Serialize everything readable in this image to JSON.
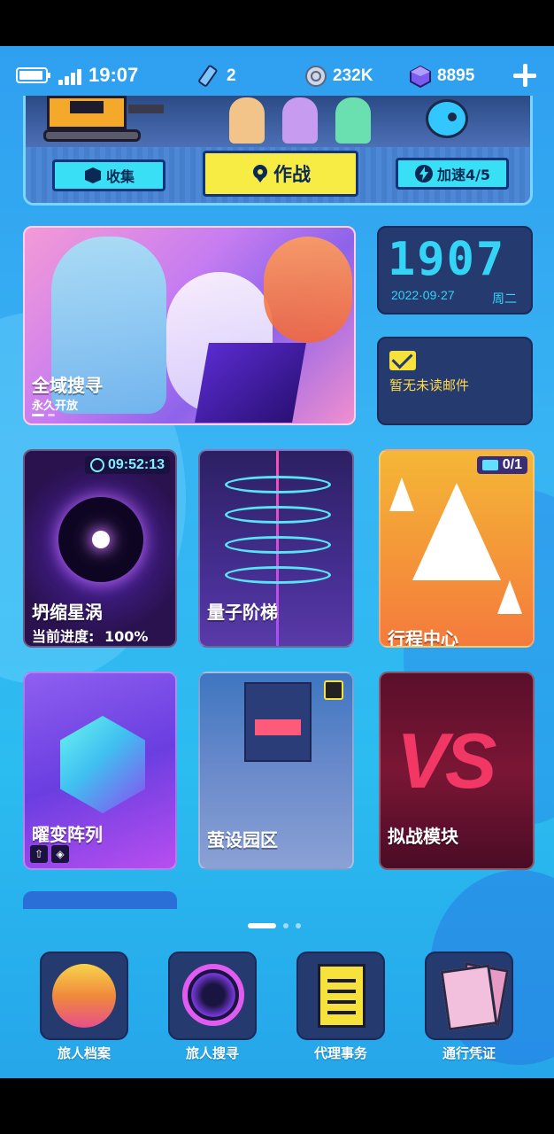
{
  "status_bar": {
    "time": "19:07",
    "resources": [
      {
        "icon": "crystal-ticket-icon",
        "value": "2"
      },
      {
        "icon": "coin-icon",
        "value": "232K"
      },
      {
        "icon": "cube-gem-icon",
        "value": "8895"
      }
    ]
  },
  "banner": {
    "collect_label": "收集",
    "battle_label": "作战",
    "boost_label": "加速4/5"
  },
  "hero_card": {
    "title": "全域搜寻",
    "subtitle": "永久开放"
  },
  "clock_card": {
    "time": "1907",
    "date": "2022·09·27",
    "weekday": "周二"
  },
  "mail_card": {
    "text": "暂无未读邮件"
  },
  "tiles": {
    "vortex": {
      "title": "坍缩星涡",
      "progress_label": "当前进度:",
      "progress_value": "100%",
      "timer": "09:52:13"
    },
    "quantum": {
      "title": "量子阶梯"
    },
    "itinerary": {
      "title": "行程中心",
      "ticket_count": "0/1"
    },
    "matrix": {
      "title": "曜变阵列"
    },
    "camp": {
      "title": "萤设园区"
    },
    "battle": {
      "title": "拟战模块",
      "art_text": "VS"
    }
  },
  "pager": {
    "pages": 3,
    "active": 0
  },
  "dock": [
    {
      "label": "旅人档案",
      "icon": "traveler-archive-icon"
    },
    {
      "label": "旅人搜寻",
      "icon": "radar-search-icon"
    },
    {
      "label": "代理事务",
      "icon": "task-list-icon"
    },
    {
      "label": "通行凭证",
      "icon": "pass-card-icon"
    }
  ],
  "colors": {
    "background": "#38b4f3",
    "panel": "#253a6e",
    "accent_cyan": "#33d4f5",
    "accent_yellow": "#f7ec44",
    "mail_text": "#ffd94a"
  }
}
